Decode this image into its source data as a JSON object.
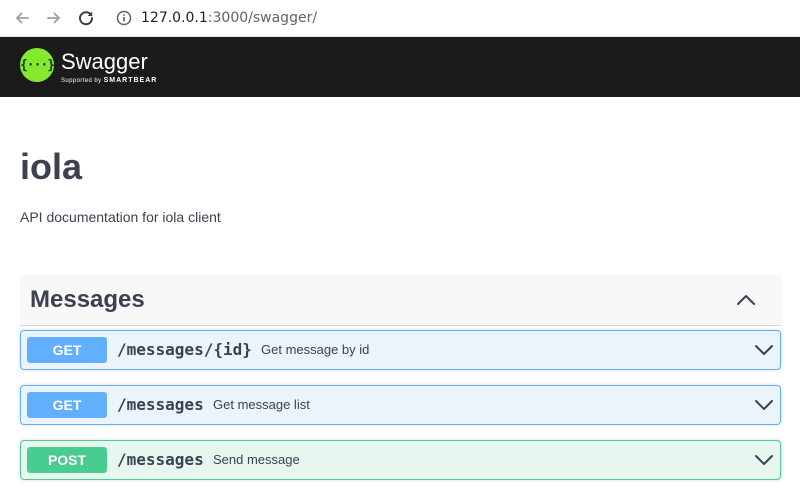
{
  "browser": {
    "url_host": "127.0.0.1",
    "url_path": ":3000/swagger/",
    "icons": [
      "back-arrow-icon",
      "forward-arrow-icon",
      "reload-icon",
      "info-icon"
    ]
  },
  "topbar": {
    "logo_symbol": "{···}",
    "brand": "Swagger",
    "supported_by": "Supported by",
    "company": "SMARTBEAR",
    "colors": {
      "background": "#1b1b1b",
      "logo": "#85ea2d"
    }
  },
  "info": {
    "title": "iola",
    "description": "API documentation for iola client"
  },
  "tag": {
    "name": "Messages",
    "expanded": true
  },
  "operations": [
    {
      "method": "GET",
      "path": "/messages/{id}",
      "summary": "Get message by id",
      "color": "#61affe"
    },
    {
      "method": "GET",
      "path": "/messages",
      "summary": "Get message list",
      "color": "#61affe"
    },
    {
      "method": "POST",
      "path": "/messages",
      "summary": "Send message",
      "color": "#49cc90"
    }
  ]
}
